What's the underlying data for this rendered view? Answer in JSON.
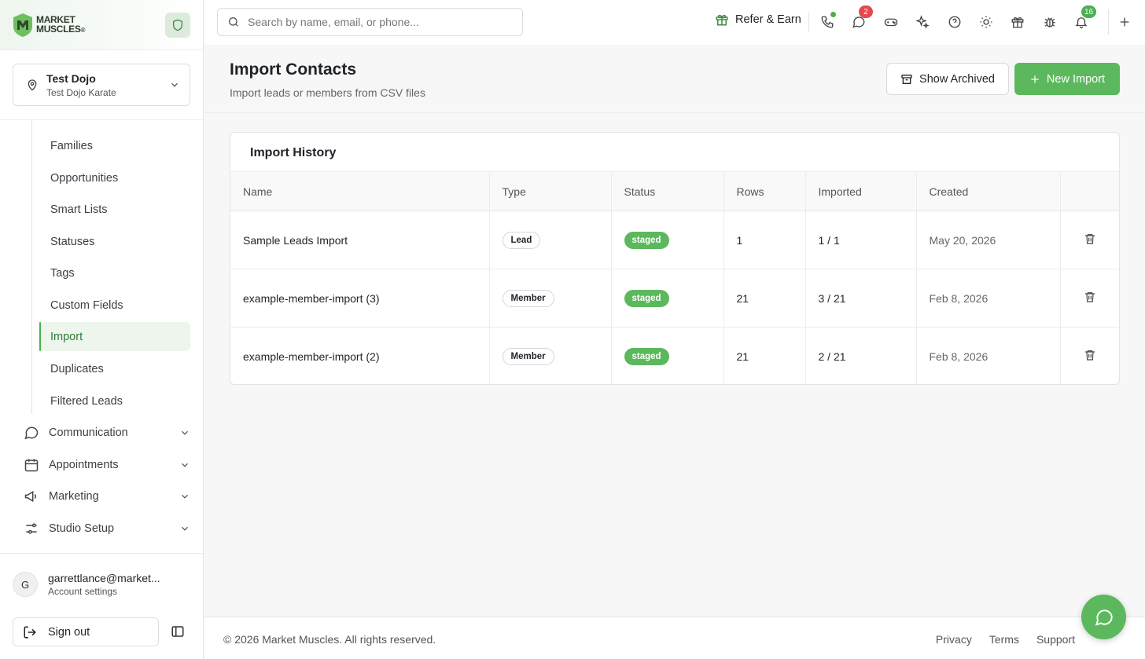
{
  "brand": {
    "line1": "MARKET",
    "line2": "MUSCLES",
    "mark": "®"
  },
  "location": {
    "name": "Test Dojo",
    "subtitle": "Test Dojo Karate"
  },
  "nav": {
    "subitems": [
      {
        "label": "Families"
      },
      {
        "label": "Opportunities"
      },
      {
        "label": "Smart Lists"
      },
      {
        "label": "Statuses"
      },
      {
        "label": "Tags"
      },
      {
        "label": "Custom Fields"
      },
      {
        "label": "Import",
        "active": true
      },
      {
        "label": "Duplicates"
      },
      {
        "label": "Filtered Leads"
      }
    ],
    "groups": [
      {
        "label": "Communication",
        "icon": "message-circle-icon"
      },
      {
        "label": "Appointments",
        "icon": "calendar-icon"
      },
      {
        "label": "Marketing",
        "icon": "megaphone-icon"
      },
      {
        "label": "Studio Setup",
        "icon": "sliders-icon"
      }
    ]
  },
  "user": {
    "initial": "G",
    "email": "garrettlance@market...",
    "subtitle": "Account settings"
  },
  "sidebar_footer": {
    "signout_label": "Sign out"
  },
  "topbar": {
    "search_placeholder": "Search by name, email, or phone...",
    "refer_label": "Refer & Earn",
    "messages_badge": "2",
    "notifications_badge": "16"
  },
  "page": {
    "title": "Import Contacts",
    "subtitle": "Import leads or members from CSV files",
    "show_archived_label": "Show Archived",
    "new_import_label": "New Import"
  },
  "history": {
    "title": "Import History",
    "columns": [
      "Name",
      "Type",
      "Status",
      "Rows",
      "Imported",
      "Created",
      ""
    ],
    "rows": [
      {
        "name": "Sample Leads Import",
        "type": "Lead",
        "status": "staged",
        "rows": "1",
        "imported": "1 / 1",
        "created": "May 20, 2026"
      },
      {
        "name": "example-member-import (3)",
        "type": "Member",
        "status": "staged",
        "rows": "21",
        "imported": "3 / 21",
        "created": "Feb 8, 2026"
      },
      {
        "name": "example-member-import (2)",
        "type": "Member",
        "status": "staged",
        "rows": "21",
        "imported": "2 / 21",
        "created": "Feb 8, 2026"
      }
    ]
  },
  "footer": {
    "copyright": "© 2026 Market Muscles. All rights reserved.",
    "links": [
      "Privacy",
      "Terms",
      "Support"
    ]
  },
  "colors": {
    "accent": "#5cb85c",
    "badge_red": "#e5484d",
    "active_bg": "#edf5ed"
  }
}
